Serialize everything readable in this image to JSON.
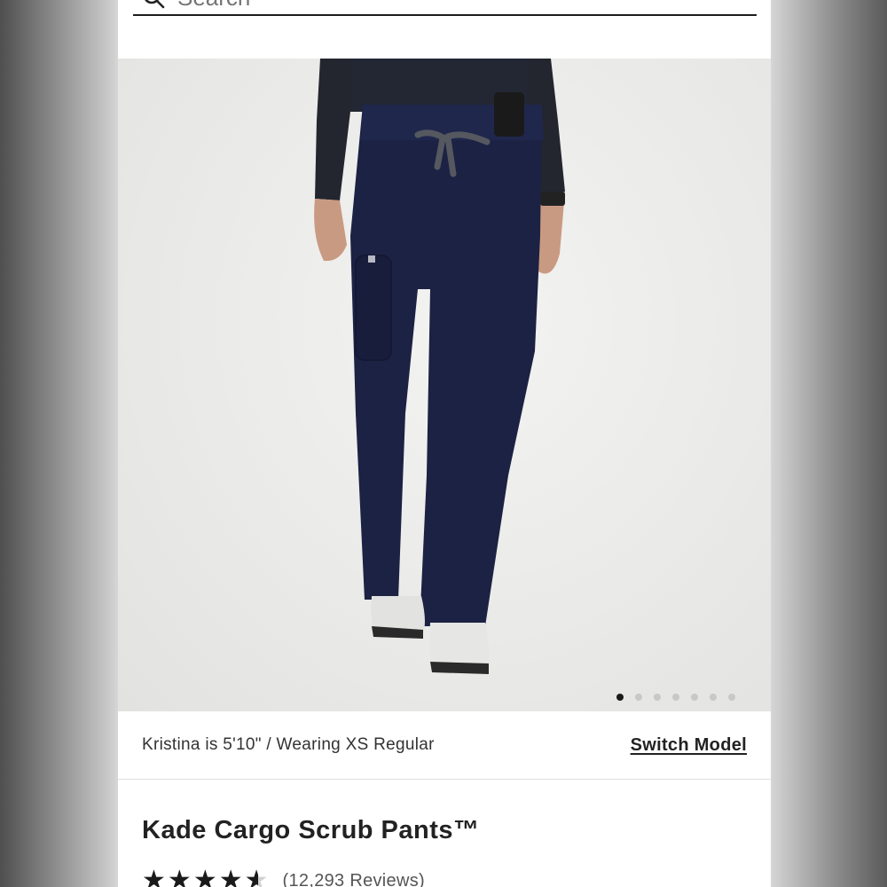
{
  "search": {
    "placeholder": "Search"
  },
  "gallery": {
    "image_alt": "Model wearing navy cargo scrub pants",
    "dot_count": 7,
    "active_dot": 0
  },
  "model_info": {
    "text": "Kristina is 5'10\" / Wearing XS Regular",
    "switch_label": "Switch Model"
  },
  "product": {
    "title": "Kade Cargo Scrub Pants™",
    "rating": 4.5,
    "reviews_label": "(12,293 Reviews)"
  },
  "colors": {
    "pants": "#1c2244",
    "top": "#23262e",
    "background": "#ececea"
  }
}
